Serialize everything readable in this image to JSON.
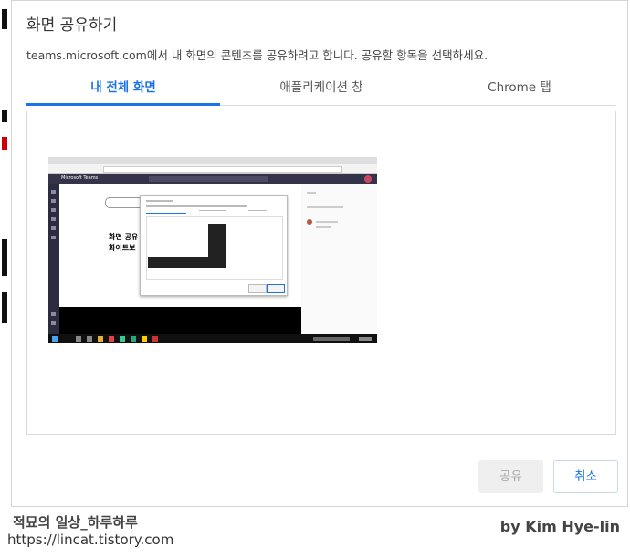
{
  "dialog": {
    "title": "화면 공유하기",
    "description": "teams.microsoft.com에서 내 화면의 콘텐츠를 공유하려고 합니다. 공유할 항목을 선택하세요.",
    "tabs": [
      {
        "label": "내 전체 화면",
        "active": true
      },
      {
        "label": "애플리케이션 창",
        "active": false
      },
      {
        "label": "Chrome 탭",
        "active": false
      }
    ],
    "thumbnail": {
      "app_label": "Microsoft Teams",
      "whiteboard_text_line1": "화면 공유",
      "whiteboard_text_line2": "화이트보"
    },
    "buttons": {
      "share_label": "공유",
      "cancel_label": "취소"
    }
  },
  "watermark": {
    "blog_name": "적묘의 일상_하루하루",
    "blog_url": "https://lincat.tistory.com",
    "author": "by Kim Hye-lin"
  },
  "colors": {
    "accent": "#1a73e8",
    "disabled_button_bg": "#efefef"
  }
}
